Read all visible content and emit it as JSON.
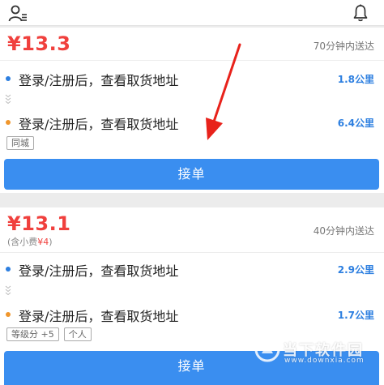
{
  "icons": {
    "profile": "user-menu-icon",
    "notifications": "bell-icon",
    "route_connector": "chevrons-down-icon"
  },
  "colors": {
    "price": "#f0403d",
    "accent": "#3a8ef0",
    "distance": "#2d7fe0",
    "pickup_dot": "#2d7fe0",
    "dropoff_dot": "#f0962c",
    "annotation_arrow": "#e8221b"
  },
  "orders": [
    {
      "price": "¥13.3",
      "eta": "70分钟内送达",
      "pickup": {
        "address": "登录/注册后，查看取货地址",
        "distance": "1.8公里"
      },
      "dropoff": {
        "address": "登录/注册后，查看取货地址",
        "distance": "6.4公里"
      },
      "tags": [
        "同城"
      ],
      "accept_label": "接单"
    },
    {
      "price": "¥13.1",
      "tip_prefix": "(含小费",
      "tip_amount": "¥4",
      "tip_suffix": ")",
      "eta": "40分钟内送达",
      "pickup": {
        "address": "登录/注册后，查看取货地址",
        "distance": "2.9公里"
      },
      "dropoff": {
        "address": "登录/注册后，查看取货地址",
        "distance": "1.7公里"
      },
      "tags": [
        "等级分 +5",
        "个人"
      ],
      "accept_label": "接单"
    }
  ],
  "watermark": {
    "name": "当下软件园",
    "url": "www.downxia.com"
  }
}
